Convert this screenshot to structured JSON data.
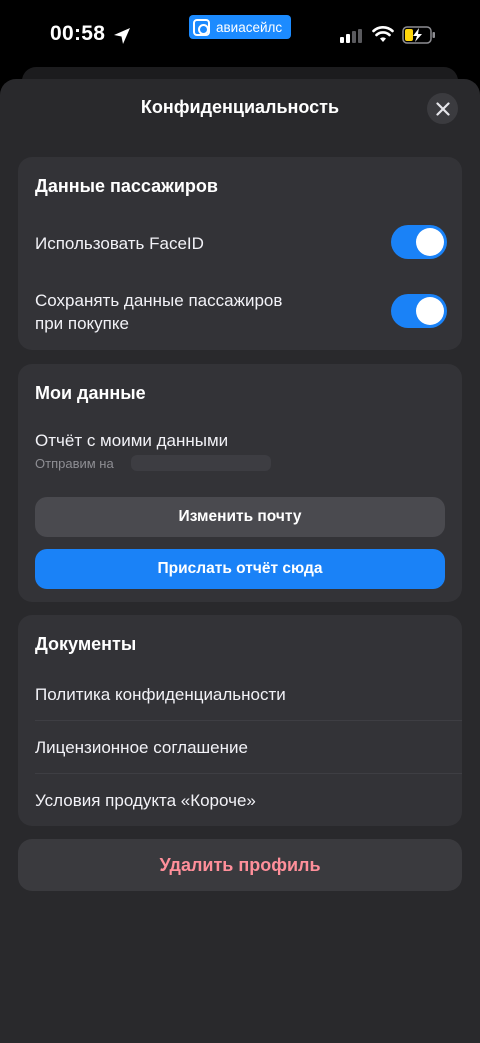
{
  "status_bar": {
    "time": "00:58",
    "app_badge_label": "авиасейлс",
    "icons": [
      "location-icon",
      "signal-icon",
      "wifi-icon",
      "battery-charging-icon"
    ]
  },
  "header": {
    "title": "Конфиденциальность",
    "close_icon": "close-icon"
  },
  "passenger_data": {
    "title": "Данные пассажиров",
    "rows": [
      {
        "label": "Использовать FaceID",
        "toggle_on": true
      },
      {
        "label_line1": "Сохранять данные пассажиров",
        "label_line2": "при покупке",
        "toggle_on": true
      }
    ]
  },
  "my_data": {
    "title": "Мои данные",
    "report_label": "Отчёт с моими данными",
    "send_to_prefix": "Отправим на",
    "change_email_button": "Изменить почту",
    "send_report_button": "Прислать отчёт сюда"
  },
  "documents": {
    "title": "Документы",
    "items": [
      "Политика конфиденциальности",
      "Лицензионное соглашение",
      "Условия продукта «Короче»"
    ]
  },
  "delete_profile_button": "Удалить профиль",
  "colors": {
    "accent": "#1a82f7",
    "sheet_bg": "#29292c",
    "card_bg": "#333337",
    "destructive": "#ff8f9a",
    "app_badge": "#1c8bff"
  }
}
